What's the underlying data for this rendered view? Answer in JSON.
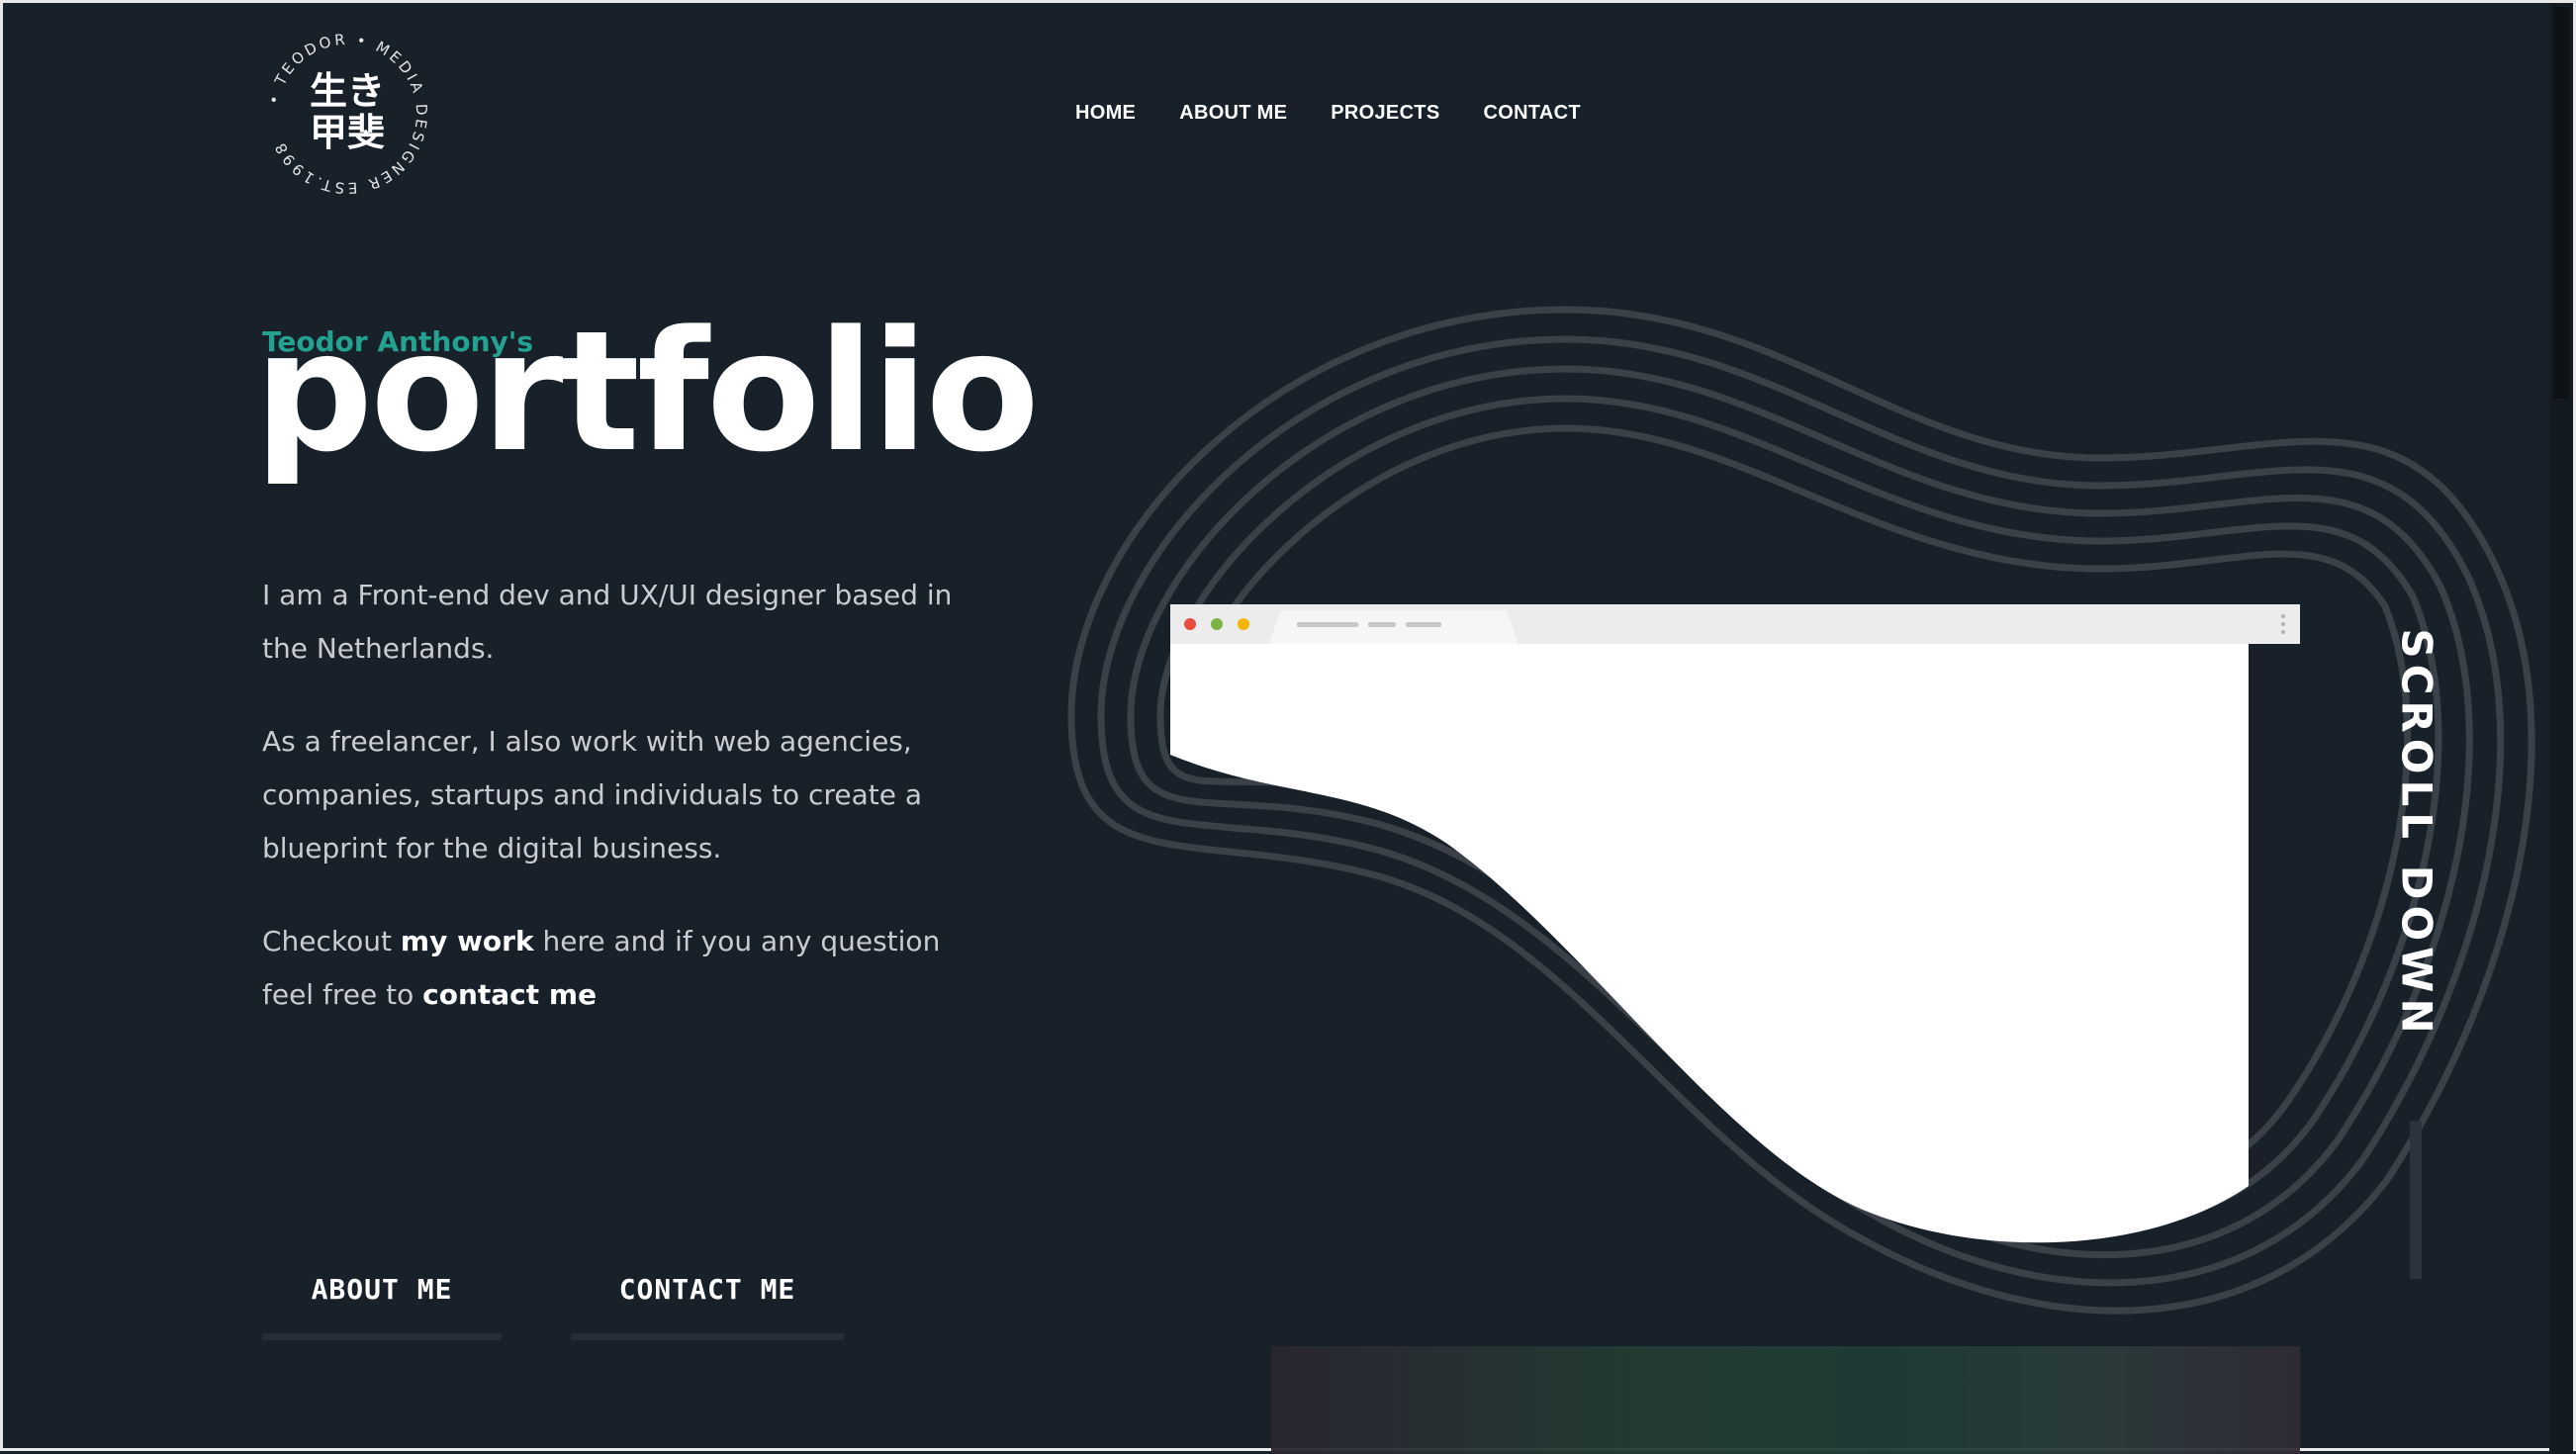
{
  "logo": {
    "kanji": "生き甲斐",
    "ring_text": "• TEODOR • MEDIA DESIGNER EST.1998"
  },
  "nav": {
    "items": [
      "HOME",
      "ABOUT ME",
      "PROJECTS",
      "CONTACT"
    ]
  },
  "hero": {
    "subtitle": "Teodor Anthony's",
    "title": "portfolio",
    "paragraph1": "I am a Front-end dev and UX/UI designer based in the Netherlands.",
    "paragraph2": "As a freelancer, I also work with web agencies, companies, startups and individuals to create a blueprint for the digital business.",
    "paragraph3_prefix": "Checkout ",
    "paragraph3_link1": "my work",
    "paragraph3_middle": " here and if you any question feel free to ",
    "paragraph3_link2": "contact me"
  },
  "buttons": {
    "about": "ABOUT ME",
    "contact": "CONTACT ME"
  },
  "scroll": {
    "label": "SCROLL DOWN"
  },
  "colors": {
    "background": "#18202a",
    "accent": "#23a191",
    "text": "#ffffff",
    "copy": "#c9cdd1"
  }
}
